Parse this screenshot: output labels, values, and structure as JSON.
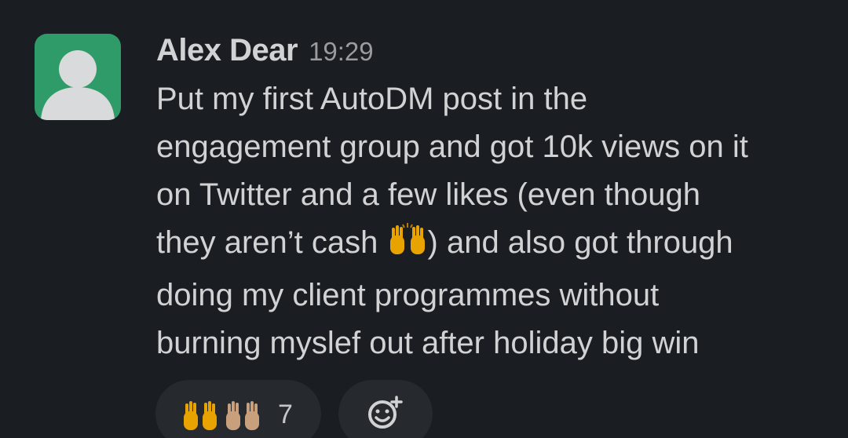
{
  "message": {
    "author": "Alex Dear",
    "time": "19:29",
    "lines": [
      "Put my first AutoDM post in the",
      "engagement group and got 10k views on it",
      "on Twitter and a few likes (even though",
      "they aren’t cash",
      ") and also got through",
      "doing my client programmes without",
      "burning myslef out after holiday big win"
    ],
    "inline_emoji": "raising-hands-emoji"
  },
  "reactions": [
    {
      "emoji": "raising-hands-emoji",
      "count": "7"
    }
  ],
  "add_reaction_icon": "add-emoji-icon",
  "colors": {
    "background": "#1a1d21",
    "avatar_bg": "#2f9b68",
    "text": "#d1d2d3",
    "muted": "#9a9b9d",
    "pill": "#26292e",
    "emoji_gold": "#e8a300",
    "emoji_skin": "#c9a07c"
  }
}
